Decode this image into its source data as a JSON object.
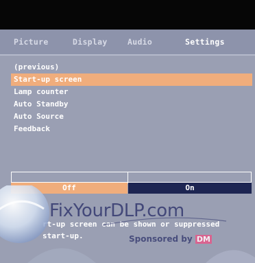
{
  "tabs": [
    {
      "label": "Picture"
    },
    {
      "label": "Display"
    },
    {
      "label": "Audio"
    },
    {
      "label": "Settings"
    }
  ],
  "active_tab": "Settings",
  "menu": {
    "items": [
      {
        "label": "(previous)"
      },
      {
        "label": "Start-up screen"
      },
      {
        "label": "Lamp counter"
      },
      {
        "label": "Auto Standby"
      },
      {
        "label": "Auto Source"
      },
      {
        "label": "Feedback"
      }
    ],
    "selected": "Start-up screen"
  },
  "toggle": {
    "off_label": "Off",
    "on_label": "On",
    "selected": "Off"
  },
  "description": {
    "line1": "rt-up screen can be shown or suppressed",
    "line2": "start-up."
  },
  "watermark": {
    "text": "FixYourDLP.com",
    "sponsor": "Sponsored by",
    "sponsor_brand": "DM"
  },
  "colors": {
    "background": "#9a9fb3",
    "highlight": "#f0ad7c",
    "on_button": "#1d2552",
    "top_bar": "#060606"
  }
}
